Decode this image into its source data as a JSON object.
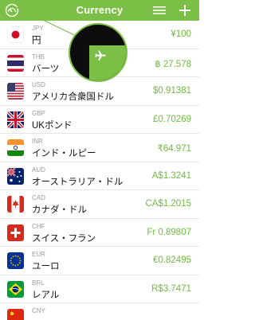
{
  "header": {
    "title": "Currency",
    "logo_icon": "gauge-icon",
    "menu_icon": "menu-icon",
    "add_icon": "plus-icon",
    "color": "#7cbf46"
  },
  "currencies": [
    {
      "code": "JPY",
      "name": "円",
      "value": "¥100",
      "flag": "japan"
    },
    {
      "code": "THB",
      "name": "バーツ",
      "value": "฿ 27.578",
      "flag": "thailand"
    },
    {
      "code": "USD",
      "name": "アメリカ合衆国ドル",
      "value": "$0.91381",
      "flag": "usa"
    },
    {
      "code": "GBP",
      "name": "UKポンド",
      "value": "£0.70269",
      "flag": "uk"
    },
    {
      "code": "INR",
      "name": "インド・ルピー",
      "value": "₹64.971",
      "flag": "india"
    },
    {
      "code": "AUD",
      "name": "オーストラリア・ドル",
      "value": "A$1.3241",
      "flag": "australia"
    },
    {
      "code": "CAD",
      "name": "カナダ・ドル",
      "value": "CA$1.2015",
      "flag": "canada"
    },
    {
      "code": "CHF",
      "name": "スイス・フラン",
      "value": "Fr 0.89807",
      "flag": "switzerland"
    },
    {
      "code": "EUR",
      "name": "ユーロ",
      "value": "€0.82495",
      "flag": "eu"
    },
    {
      "code": "BRL",
      "name": "レアル",
      "value": "R$3.7471",
      "flag": "brazil"
    },
    {
      "code": "CNY",
      "name": "",
      "value": "",
      "flag": "china"
    }
  ],
  "overlay": {
    "icon": "airplane-icon"
  },
  "colors": {
    "accent": "#7cbf46",
    "value_text": "#6fbb3f"
  }
}
